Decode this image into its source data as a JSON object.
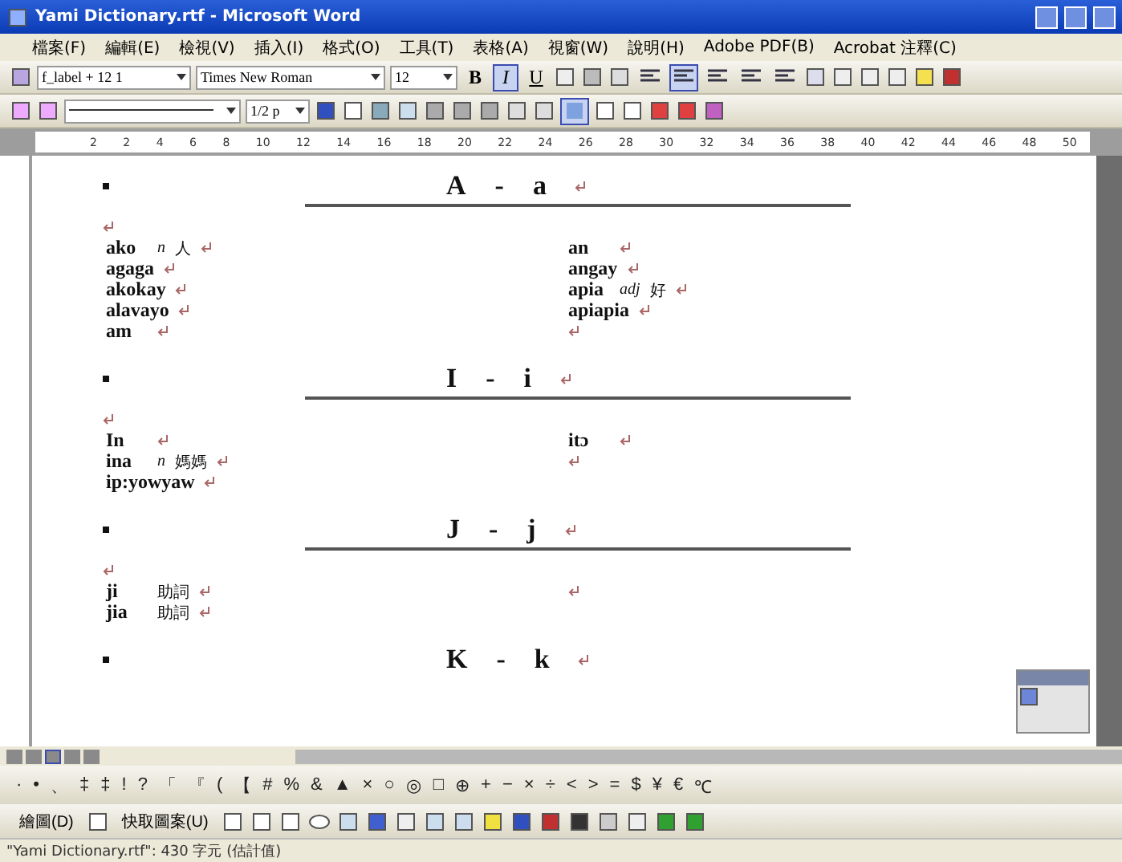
{
  "window": {
    "title": "Yami Dictionary.rtf - Microsoft Word"
  },
  "menu": [
    "檔案(F)",
    "編輯(E)",
    "檢視(V)",
    "插入(I)",
    "格式(O)",
    "工具(T)",
    "表格(A)",
    "視窗(W)",
    "說明(H)",
    "Adobe PDF(B)",
    "Acrobat 注釋(C)"
  ],
  "format_toolbar": {
    "style": "f_label + 12 1",
    "font": "Times New Roman",
    "size": "12",
    "text_buttons": [
      {
        "label": "B",
        "selected": false
      },
      {
        "label": "I",
        "selected": true
      },
      {
        "label": "U",
        "selected": false
      }
    ],
    "alignment": [
      {
        "selected": false
      },
      {
        "selected": true
      },
      {
        "selected": false
      },
      {
        "selected": false
      },
      {
        "selected": false
      }
    ]
  },
  "tables_toolbar": {
    "line_weight": "1/2 p",
    "autoformat_selected": true
  },
  "ruler": [
    "2",
    "2",
    "4",
    "6",
    "8",
    "10",
    "12",
    "14",
    "16",
    "18",
    "20",
    "22",
    "24",
    "26",
    "28",
    "30",
    "32",
    "34",
    "36",
    "38",
    "40",
    "42",
    "44",
    "46",
    "48",
    "50"
  ],
  "sections": [
    {
      "upper": "A",
      "separator": "-",
      "lower": "a",
      "left": [
        {
          "word": "ako",
          "pos": "n",
          "gloss": "人"
        },
        {
          "word": "agaga"
        },
        {
          "word": "akokay"
        },
        {
          "word": "alavayo"
        },
        {
          "word": "am"
        }
      ],
      "right": [
        {
          "word": "an"
        },
        {
          "word": "angay"
        },
        {
          "word": "apia",
          "pos": "adj",
          "gloss": "好"
        },
        {
          "word": "apiapia"
        },
        {
          "kind": "empty"
        }
      ]
    },
    {
      "upper": "I",
      "separator": "-",
      "lower": "i",
      "left": [
        {
          "word": "In"
        },
        {
          "word": "ina",
          "pos": "n",
          "gloss": "媽媽"
        },
        {
          "word": "ip:yowyaw"
        }
      ],
      "right": [
        {
          "word": "itɔ"
        },
        {
          "kind": "empty"
        }
      ]
    },
    {
      "upper": "J",
      "separator": "-",
      "lower": "j",
      "left": [
        {
          "word": "ji",
          "gloss": "助詞"
        },
        {
          "word": "jia",
          "gloss": "助詞"
        }
      ],
      "right": [
        {
          "kind": "empty"
        }
      ]
    },
    {
      "upper": "K",
      "separator": "-",
      "lower": "k"
    }
  ],
  "symbols": [
    "·",
    "•",
    "、",
    "‡",
    "‡",
    "!",
    "?",
    "「",
    "『",
    "(",
    "【",
    "#",
    "%",
    "&",
    "▲",
    "×",
    "○",
    "◎",
    "□",
    "⊕",
    "+",
    "−",
    "×",
    "÷",
    "<",
    ">",
    "=",
    "$",
    "¥",
    "€",
    "℃"
  ],
  "drawing_toolbar": {
    "draw": "繪圖(D)",
    "autoshapes": "快取圖案(U)"
  },
  "status_bar": "\"Yami Dictionary.rtf\": 430 字元 (估計值)"
}
